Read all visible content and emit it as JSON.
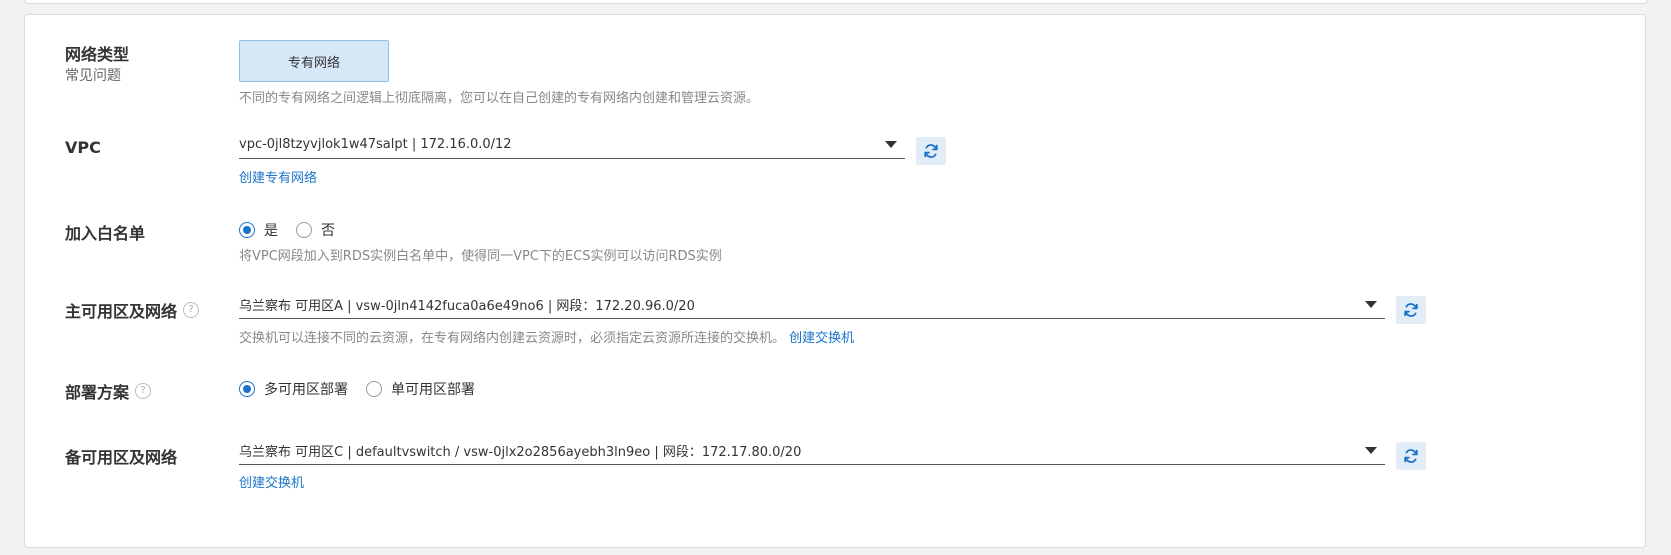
{
  "network_type": {
    "label": "网络类型",
    "sublabel": "常见问题",
    "button_label": "专有网络",
    "hint": "不同的专有网络之间逻辑上彻底隔离，您可以在自己创建的专有网络内创建和管理云资源。"
  },
  "vpc": {
    "label": "VPC",
    "selected": "vpc-0jl8tzyvjlok1w47salpt | 172.16.0.0/12",
    "create_link": "创建专有网络"
  },
  "whitelist": {
    "label": "加入白名单",
    "options": [
      "是",
      "否"
    ],
    "selected": "是",
    "hint": "将VPC网段加入到RDS实例白名单中，使得同一VPC下的ECS实例可以访问RDS实例"
  },
  "primary_zone": {
    "label": "主可用区及网络",
    "help": "?",
    "selected": "乌兰察布 可用区A | vsw-0jln4142fuca0a6e49no6 | 网段：172.20.96.0/20",
    "hint": "交换机可以连接不同的云资源，在专有网络内创建云资源时，必须指定云资源所连接的交换机。",
    "create_link": "创建交换机"
  },
  "deployment": {
    "label": "部署方案",
    "help": "?",
    "options": [
      "多可用区部署",
      "单可用区部署"
    ],
    "selected": "多可用区部署"
  },
  "secondary_zone": {
    "label": "备可用区及网络",
    "selected": "乌兰察布 可用区C | defaultvswitch / vsw-0jlx2o2856ayebh3ln9eo | 网段：172.17.80.0/20",
    "create_link": "创建交换机"
  },
  "colors": {
    "accent": "#1a73c9",
    "button_bg": "#d6e8f7",
    "refresh_bg": "#e2edf7"
  }
}
